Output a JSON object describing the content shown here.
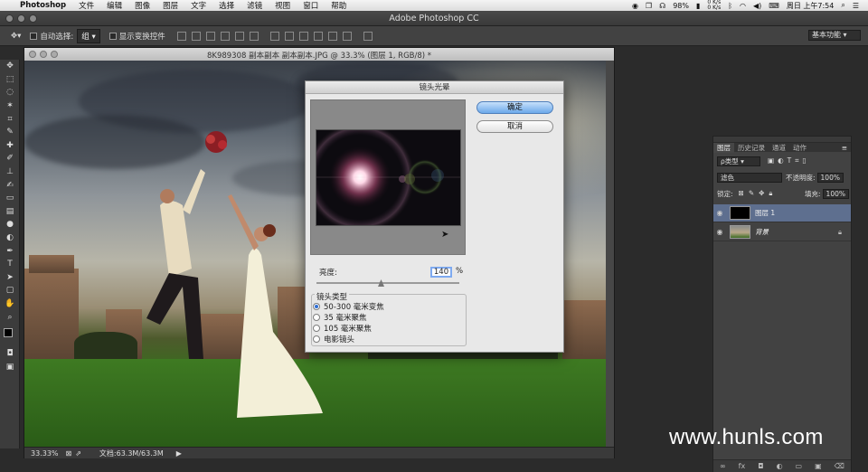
{
  "menubar": {
    "app_name": "Photoshop",
    "items": [
      "文件",
      "编辑",
      "图像",
      "图层",
      "文字",
      "选择",
      "滤镜",
      "视图",
      "窗口",
      "帮助"
    ],
    "battery": "98%",
    "net_up": "0 K/s",
    "net_down": "0 K/s",
    "clock": "周日 上午7:54"
  },
  "window": {
    "title": "Adobe Photoshop CC",
    "workspace": "基本功能"
  },
  "options": {
    "auto_select_label": "自动选择:",
    "auto_select_value": "组",
    "show_transform_label": "显示变换控件"
  },
  "tools": [
    "move-tool",
    "marquee-tool",
    "lasso-tool",
    "magic-wand-tool",
    "crop-tool",
    "eyedropper-tool",
    "healing-tool",
    "brush-tool",
    "stamp-tool",
    "history-brush-tool",
    "eraser-tool",
    "gradient-tool",
    "blur-tool",
    "dodge-tool",
    "pen-tool",
    "type-tool",
    "path-select-tool",
    "shape-tool",
    "hand-tool",
    "zoom-tool"
  ],
  "tool_glyphs": [
    "✥",
    "⬚",
    "◌",
    "✶",
    "⌗",
    "✎",
    "✚",
    "✐",
    "⊥",
    "✍",
    "▭",
    "▤",
    "●",
    "◐",
    "✒",
    "T",
    "➤",
    "▢",
    "✋",
    "⌕"
  ],
  "document": {
    "tab_title": "8K989308 副本副本 副本副本.JPG @ 33.3% (图层 1, RGB/8) *",
    "zoom": "33.33%",
    "doc_size": "文档:63.3M/63.3M"
  },
  "dialog": {
    "title": "镜头光晕",
    "ok_label": "确定",
    "cancel_label": "取消",
    "brightness_label": "亮度:",
    "brightness_value": "140",
    "brightness_unit": "%",
    "lens_type_label": "镜头类型",
    "lens_options": [
      "50-300 毫米变焦",
      "35 毫米聚焦",
      "105 毫米聚焦",
      "电影镜头"
    ],
    "selected_lens": 0
  },
  "layers_panel": {
    "tabs": [
      "图层",
      "历史记录",
      "通道",
      "动作"
    ],
    "filter_label": "ρ类型",
    "blend_mode": "滤色",
    "opacity_label": "不透明度:",
    "opacity_value": "100%",
    "lock_label": "锁定:",
    "fill_label": "填充:",
    "fill_value": "100%",
    "layers": [
      {
        "name": "图层 1",
        "selected": true
      },
      {
        "name": "背景",
        "selected": false
      }
    ]
  },
  "watermark": "www.hunls.com",
  "colors": {
    "accent": "#6ca9ea",
    "panel": "#424242",
    "selected_layer": "#5e6f8f"
  }
}
